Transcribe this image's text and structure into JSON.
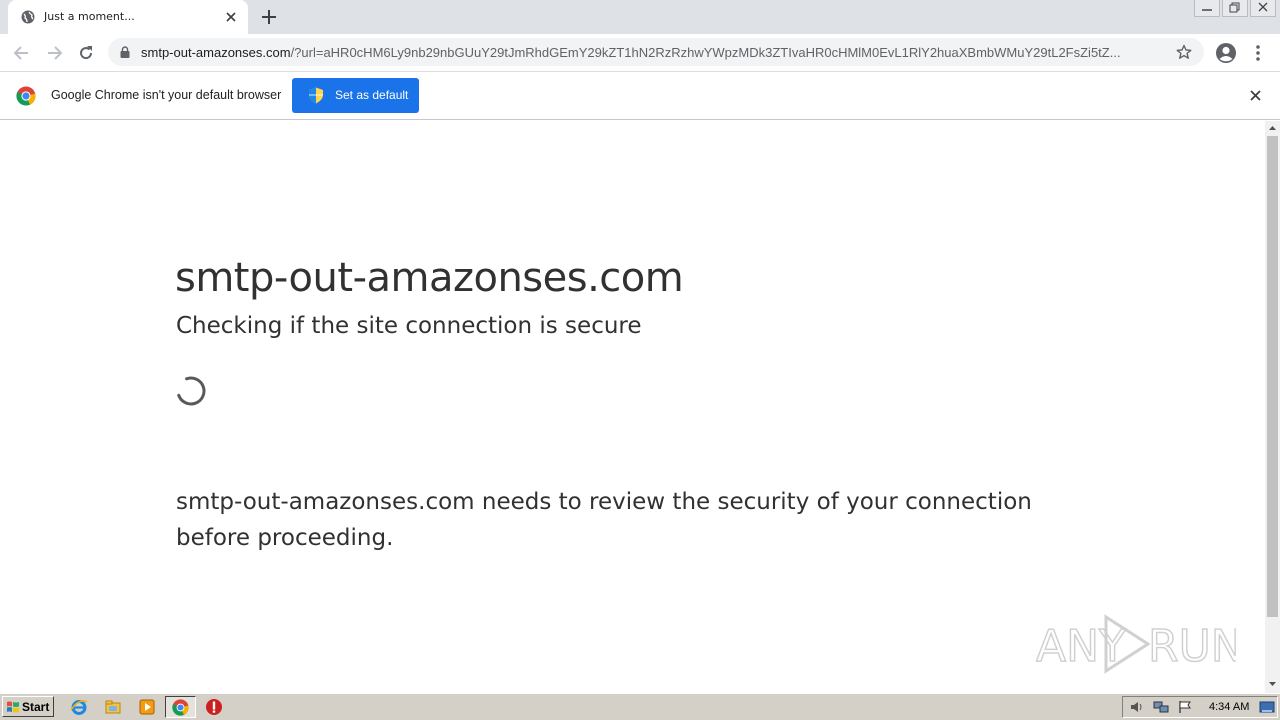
{
  "browser": {
    "tab": {
      "title": "Just a moment..."
    },
    "url": {
      "host": "smtp-out-amazonses.com",
      "path": "/?url=aHR0cHM6Ly9nb29nbGUuY29tJmRhdGEmY29kZT1hN2RzRzhwYWpzMDk3ZTIvaHR0cHMlM0EvL1RlY2huaXBmbWMuY29tL2FsZi5tZ..."
    },
    "infobar": {
      "message": "Google Chrome isn't your default browser",
      "button_label": "Set as default"
    }
  },
  "page": {
    "heading": "smtp-out-amazonses.com",
    "subheading": "Checking if the site connection is secure",
    "paragraph": "smtp-out-amazonses.com needs to review the security of your connection before proceeding."
  },
  "watermark": {
    "text": "ANY RUN"
  },
  "taskbar": {
    "start_label": "Start",
    "clock": "4:34 AM",
    "icons": [
      "ie-icon",
      "explorer-icon",
      "media-player-icon",
      "chrome-icon",
      "stop-icon"
    ]
  },
  "colors": {
    "accent": "#1a73e8",
    "tabstrip": "#dee1e6",
    "text": "#313131"
  }
}
